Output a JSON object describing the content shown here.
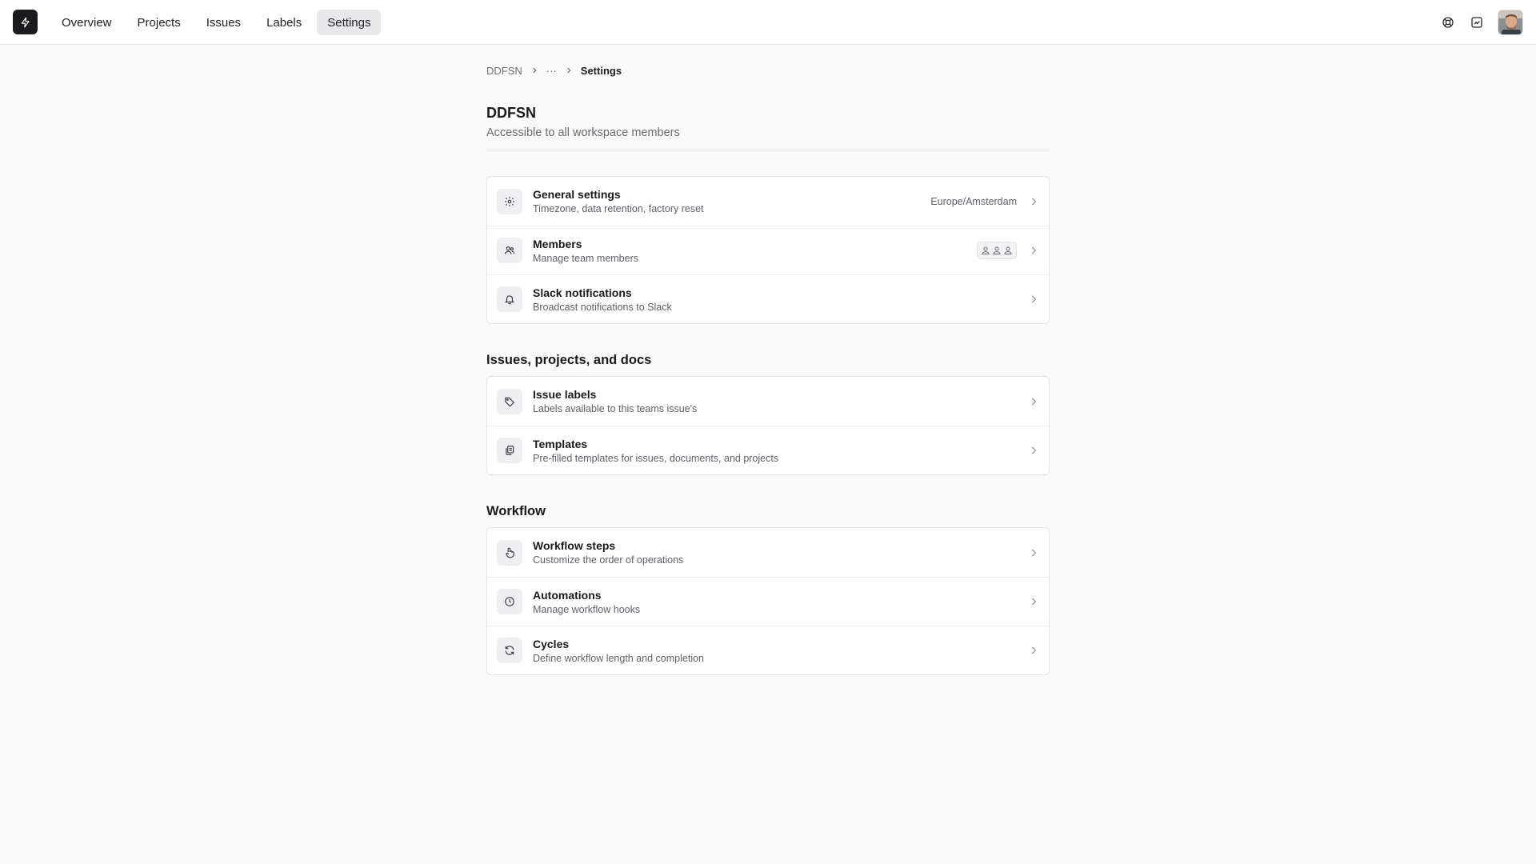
{
  "nav": {
    "items": [
      {
        "label": "Overview",
        "active": false
      },
      {
        "label": "Projects",
        "active": false
      },
      {
        "label": "Issues",
        "active": false
      },
      {
        "label": "Labels",
        "active": false
      },
      {
        "label": "Settings",
        "active": true
      }
    ]
  },
  "breadcrumb": {
    "root": "DDFSN",
    "ellipsis": "···",
    "current": "Settings"
  },
  "page": {
    "title": "DDFSN",
    "subtitle": "Accessible to all workspace members"
  },
  "general": {
    "items": [
      {
        "title": "General settings",
        "desc": "Timezone, data retention, factory reset",
        "meta": "Europe/Amsterdam",
        "icon": "gear-icon"
      },
      {
        "title": "Members",
        "desc": "Manage team members",
        "icon": "users-icon"
      },
      {
        "title": "Slack notifications",
        "desc": "Broadcast notifications to Slack",
        "icon": "bell-icon"
      }
    ]
  },
  "issues_section": {
    "title": "Issues, projects, and docs",
    "items": [
      {
        "title": "Issue labels",
        "desc": "Labels available to this teams issue's",
        "icon": "tag-icon"
      },
      {
        "title": "Templates",
        "desc": "Pre-filled templates for issues, documents, and projects",
        "icon": "templates-icon"
      }
    ]
  },
  "workflow_section": {
    "title": "Workflow",
    "items": [
      {
        "title": "Workflow steps",
        "desc": "Customize the order of operations",
        "icon": "pointer-icon"
      },
      {
        "title": "Automations",
        "desc": "Manage workflow hooks",
        "icon": "clock-icon"
      },
      {
        "title": "Cycles",
        "desc": "Define workflow length and completion",
        "icon": "refresh-icon"
      }
    ]
  },
  "colors": {
    "background": "#fafafa",
    "logo_bg": "#1b1b1d",
    "active_nav": "#e8e8ea"
  }
}
